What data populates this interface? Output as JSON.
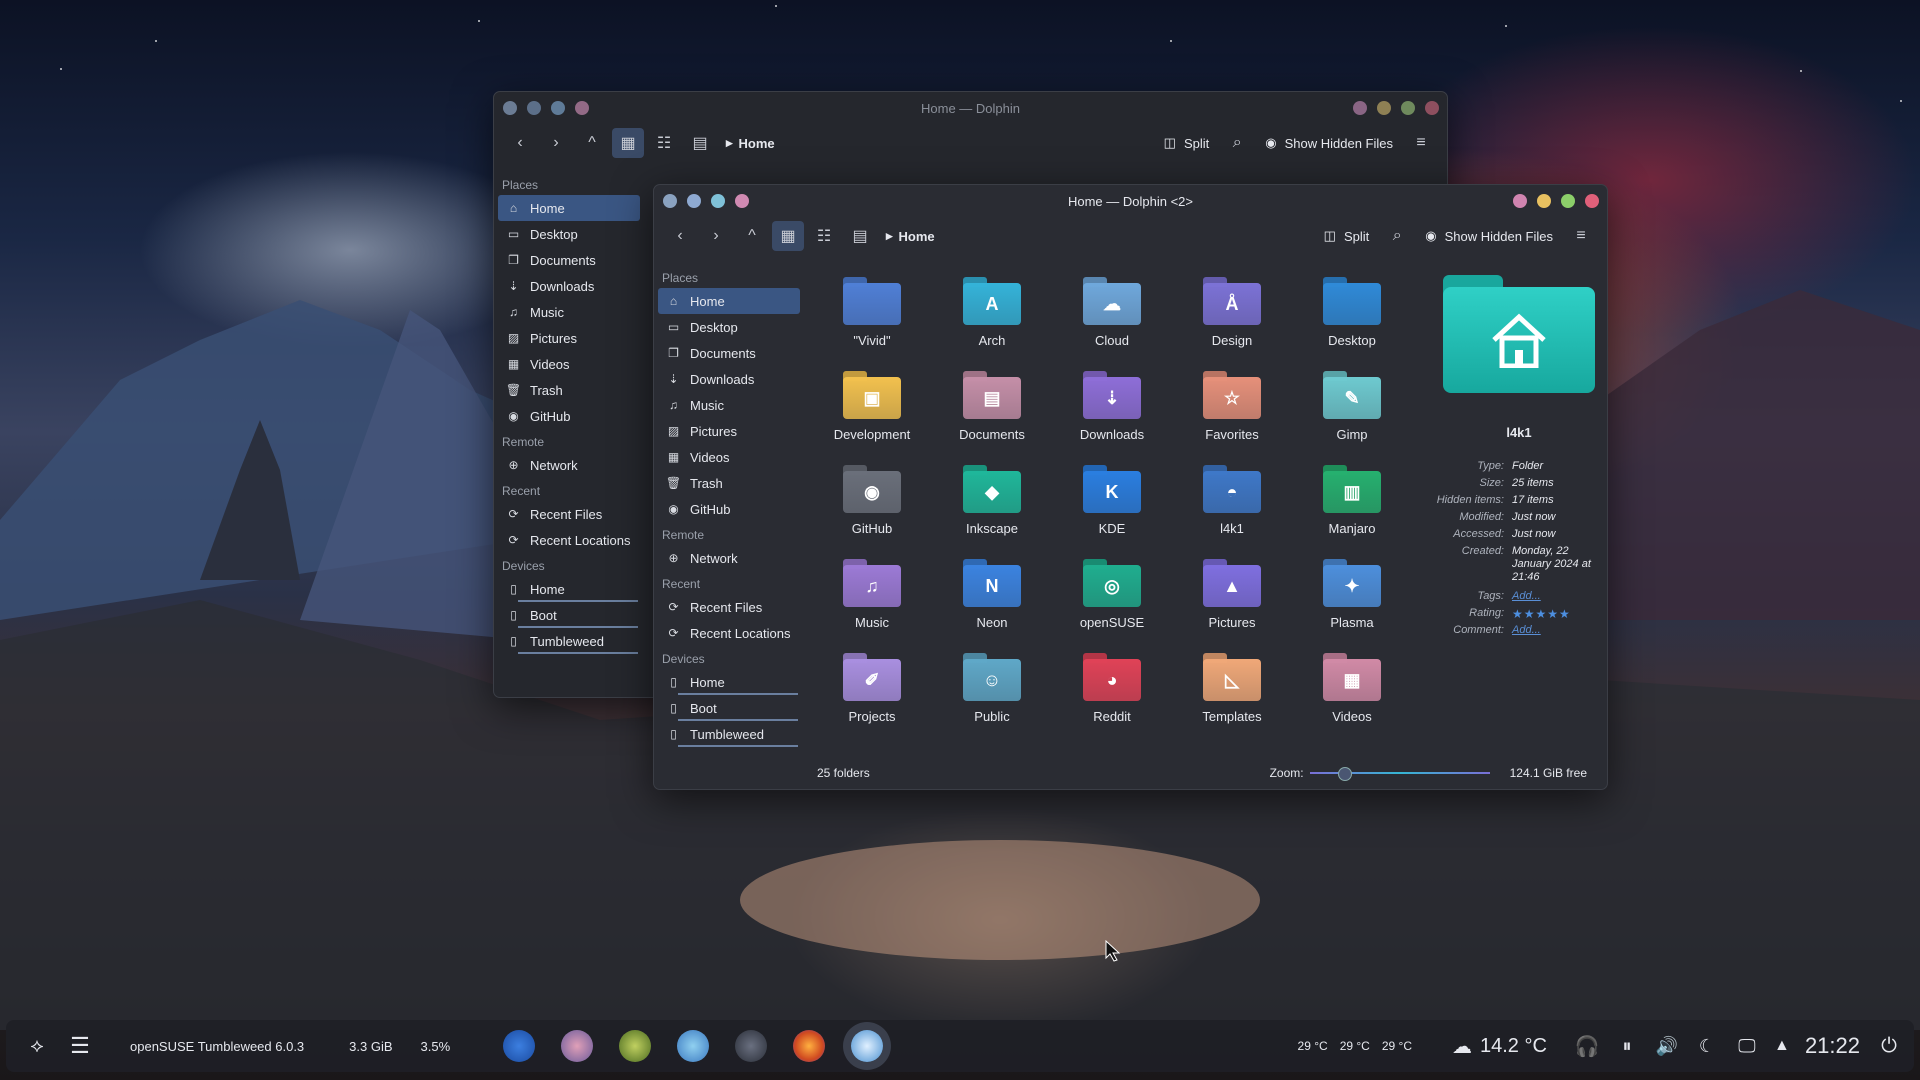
{
  "window_back": {
    "title": "Home — Dolphin",
    "breadcrumb": "Home",
    "split_label": "Split",
    "hidden_label": "Show Hidden Files"
  },
  "window_front": {
    "title": "Home — Dolphin <2>",
    "breadcrumb": "Home",
    "split_label": "Split",
    "hidden_label": "Show Hidden Files"
  },
  "sidebar": {
    "places_header": "Places",
    "places": [
      {
        "label": "Home",
        "icon": "home-icon"
      },
      {
        "label": "Desktop",
        "icon": "desktop-icon"
      },
      {
        "label": "Documents",
        "icon": "documents-icon"
      },
      {
        "label": "Downloads",
        "icon": "download-icon"
      },
      {
        "label": "Music",
        "icon": "music-icon"
      },
      {
        "label": "Pictures",
        "icon": "pictures-icon"
      },
      {
        "label": "Videos",
        "icon": "videos-icon"
      },
      {
        "label": "Trash",
        "icon": "trash-icon"
      },
      {
        "label": "GitHub",
        "icon": "github-icon"
      }
    ],
    "remote_header": "Remote",
    "remote": [
      {
        "label": "Network",
        "icon": "network-icon"
      }
    ],
    "recent_header": "Recent",
    "recent": [
      {
        "label": "Recent Files",
        "icon": "recent-files-icon"
      },
      {
        "label": "Recent Locations",
        "icon": "recent-locations-icon"
      }
    ],
    "devices_header": "Devices",
    "devices": [
      {
        "label": "Home",
        "icon": "drive-icon"
      },
      {
        "label": "Boot",
        "icon": "drive-icon"
      },
      {
        "label": "Tumbleweed",
        "icon": "drive-icon"
      }
    ]
  },
  "folders": [
    {
      "name": "\"Vivid\"",
      "color": "#4f7fd6",
      "glyph": ""
    },
    {
      "name": "Arch",
      "color": "#34b3d9",
      "glyph": "A"
    },
    {
      "name": "Cloud",
      "color": "#6fa8dc",
      "glyph": "☁"
    },
    {
      "name": "Design",
      "color": "#7c72d6",
      "glyph": "Å"
    },
    {
      "name": "Desktop",
      "color": "#2f8ad8",
      "glyph": ""
    },
    {
      "name": "Development",
      "color": "#f2c14e",
      "glyph": "▣"
    },
    {
      "name": "Documents",
      "color": "#c58fa8",
      "glyph": "▤"
    },
    {
      "name": "Downloads",
      "color": "#8e6ed8",
      "glyph": "⇣"
    },
    {
      "name": "Favorites",
      "color": "#e6907a",
      "glyph": "☆"
    },
    {
      "name": "Gimp",
      "color": "#6ecad0",
      "glyph": "✎"
    },
    {
      "name": "GitHub",
      "color": "#6a6f7a",
      "glyph": "◉"
    },
    {
      "name": "Inkscape",
      "color": "#1fb79a",
      "glyph": "◆"
    },
    {
      "name": "KDE",
      "color": "#2a7ee0",
      "glyph": "K"
    },
    {
      "name": "l4k1",
      "color": "#3e78c8",
      "glyph": "◓"
    },
    {
      "name": "Manjaro",
      "color": "#26b06f",
      "glyph": "▥"
    },
    {
      "name": "Music",
      "color": "#9c7ad6",
      "glyph": "♫"
    },
    {
      "name": "Neon",
      "color": "#3b83e0",
      "glyph": "N"
    },
    {
      "name": "openSUSE",
      "color": "#1fae8f",
      "glyph": "◎"
    },
    {
      "name": "Pictures",
      "color": "#7f6fe0",
      "glyph": "▲"
    },
    {
      "name": "Plasma",
      "color": "#4d8fdc",
      "glyph": "✦"
    },
    {
      "name": "Projects",
      "color": "#a98fe0",
      "glyph": "✐"
    },
    {
      "name": "Public",
      "color": "#5fa8c8",
      "glyph": "☺"
    },
    {
      "name": "Reddit",
      "color": "#e04257",
      "glyph": "◕"
    },
    {
      "name": "Templates",
      "color": "#f0a878",
      "glyph": "◺"
    },
    {
      "name": "Videos",
      "color": "#d18aa6",
      "glyph": "▦"
    }
  ],
  "info_panel": {
    "name": "l4k1",
    "type_k": "Type:",
    "type_v": "Folder",
    "size_k": "Size:",
    "size_v": "25 items",
    "hidden_k": "Hidden items:",
    "hidden_v": "17 items",
    "modified_k": "Modified:",
    "modified_v": "Just now",
    "accessed_k": "Accessed:",
    "accessed_v": "Just now",
    "created_k": "Created:",
    "created_v1": "Monday, 22",
    "created_v2": "January 2024 at",
    "created_v3": "21:46",
    "tags_k": "Tags:",
    "tags_v": "Add...",
    "rating_k": "Rating:",
    "rating_v": 5,
    "comment_k": "Comment:",
    "comment_v": "Add..."
  },
  "statusbar": {
    "count": "25 folders",
    "zoom_label": "Zoom:",
    "zoom_level": 0.17,
    "free": "124.1 GiB free"
  },
  "taskbar": {
    "distro": "openSUSE Tumbleweed 6.0.3",
    "mem": "3.3 GiB",
    "cpu": "3.5%",
    "temps": [
      "29 °C",
      "29 °C",
      "29 °C"
    ],
    "weather": "14.2 °C",
    "clock": "21:22"
  },
  "colors": {
    "selection": "#3a5683",
    "accent": "#5ab0e8",
    "close": "#e0607a",
    "minimize": "#e8c060",
    "maximize": "#8ccf6a"
  }
}
